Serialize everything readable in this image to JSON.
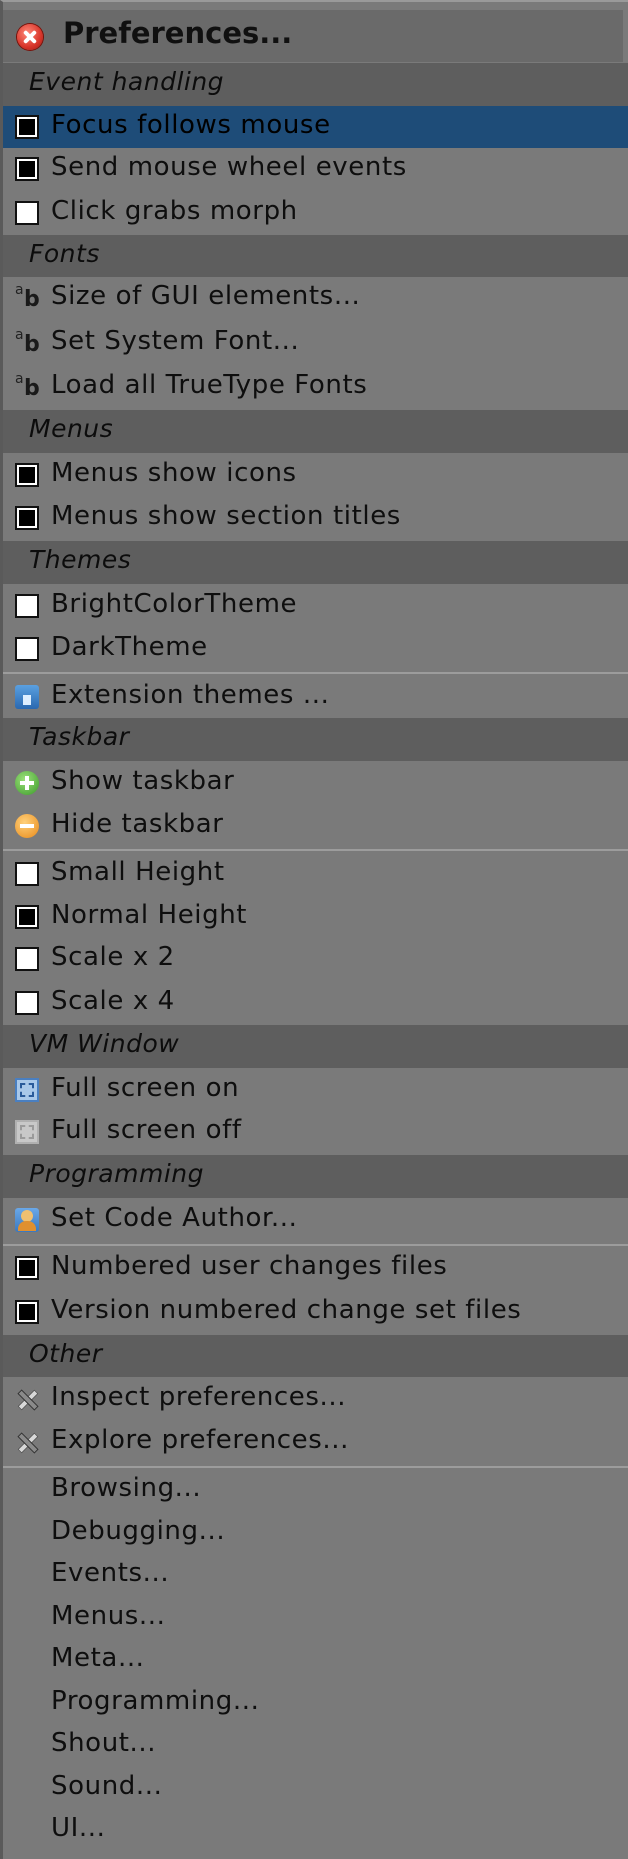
{
  "title": "Preferences...",
  "sections": {
    "event_handling": "Event handling",
    "fonts": "Fonts",
    "menus": "Menus",
    "themes": "Themes",
    "taskbar": "Taskbar",
    "vm_window": "VM Window",
    "programming": "Programming",
    "other": "Other"
  },
  "items": {
    "focus_follows_mouse": "Focus follows mouse",
    "send_mouse_wheel": "Send mouse wheel events",
    "click_grabs_morph": "Click grabs morph",
    "size_gui": "Size of GUI elements...",
    "set_system_font": "Set System Font...",
    "load_truetype": "Load all TrueType Fonts",
    "menus_show_icons": "Menus show icons",
    "menus_show_section_titles": "Menus show section titles",
    "bright_theme": "BrightColorTheme",
    "dark_theme": "DarkTheme",
    "extension_themes": "Extension themes ...",
    "show_taskbar": "Show taskbar",
    "hide_taskbar": "Hide taskbar",
    "small_height": "Small Height",
    "normal_height": "Normal Height",
    "scale_x2": "Scale x 2",
    "scale_x4": "Scale x 4",
    "full_screen_on": "Full screen on",
    "full_screen_off": "Full screen off",
    "set_code_author": "Set Code Author...",
    "numbered_user_changes": "Numbered user changes files",
    "version_numbered_changeset": "Version numbered change set files",
    "inspect_prefs": "Inspect preferences...",
    "explore_prefs": "Explore preferences...",
    "browsing": "Browsing...",
    "debugging": "Debugging...",
    "events": "Events...",
    "menus_sub": "Menus...",
    "meta": "Meta...",
    "programming_sub": "Programming...",
    "shout": "Shout...",
    "sound": "Sound...",
    "ui": "UI..."
  },
  "checked": {
    "focus_follows_mouse": true,
    "send_mouse_wheel": true,
    "click_grabs_morph": false,
    "menus_show_icons": true,
    "menus_show_section_titles": true,
    "bright_theme": false,
    "dark_theme": false,
    "small_height": false,
    "normal_height": true,
    "scale_x2": false,
    "scale_x4": false,
    "numbered_user_changes": true,
    "version_numbered_changeset": true
  },
  "colors": {
    "menu_bg": "#7a7a7a",
    "section_bg": "#5e5e5e",
    "highlight": "#1e4c78",
    "close_button": "#d8352a"
  },
  "icons": {
    "close": "close-icon",
    "font": "font-icon",
    "theme": "theme-icon",
    "show": "plus-icon",
    "hide": "minus-icon",
    "full_screen_on": "fullscreen-icon",
    "full_screen_off": "fullscreen-off-icon",
    "author": "author-icon",
    "tools": "tools-icon"
  }
}
